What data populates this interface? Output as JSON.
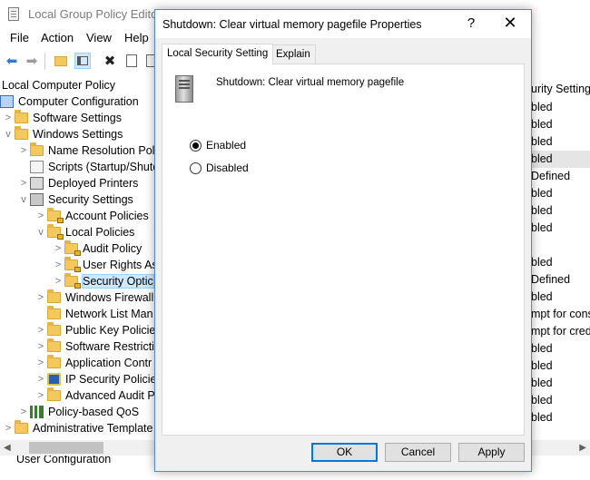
{
  "editor": {
    "title": "Local Group Policy Editor",
    "menu": [
      "File",
      "Action",
      "View",
      "Help"
    ],
    "toolbar_icons": [
      "back-arrow-icon",
      "forward-arrow-icon",
      "up-folder-icon",
      "show-hide-tree-icon",
      "delete-icon",
      "properties-icon",
      "export-list-icon"
    ],
    "tree": [
      {
        "label": "Local Computer Policy",
        "icon": "computer-icon"
      },
      {
        "label": "Computer Configuration",
        "icon": "computer-icon"
      },
      {
        "label": "Software Settings",
        "icon": "folder-icon"
      },
      {
        "label": "Windows Settings",
        "icon": "folder-icon"
      },
      {
        "label": "Name Resolution Pol",
        "icon": "folder-icon"
      },
      {
        "label": "Scripts (Startup/Shutd",
        "icon": "script-icon"
      },
      {
        "label": "Deployed Printers",
        "icon": "printer-icon"
      },
      {
        "label": "Security Settings",
        "icon": "security-settings-icon"
      },
      {
        "label": "Account Policies",
        "icon": "locked-folder-icon"
      },
      {
        "label": "Local Policies",
        "icon": "locked-folder-icon"
      },
      {
        "label": "Audit Policy",
        "icon": "locked-folder-icon"
      },
      {
        "label": "User Rights As",
        "icon": "locked-folder-icon"
      },
      {
        "label": "Security Optic",
        "icon": "locked-folder-icon"
      },
      {
        "label": "Windows Firewall",
        "icon": "folder-icon"
      },
      {
        "label": "Network List Man",
        "icon": "folder-icon"
      },
      {
        "label": "Public Key Policie",
        "icon": "folder-icon"
      },
      {
        "label": "Software Restricti",
        "icon": "folder-icon"
      },
      {
        "label": "Application Contr",
        "icon": "folder-icon"
      },
      {
        "label": "IP Security Policie",
        "icon": "ip-security-icon"
      },
      {
        "label": "Advanced Audit P",
        "icon": "folder-icon"
      },
      {
        "label": "Policy-based QoS",
        "icon": "qos-icon"
      },
      {
        "label": "Administrative Template",
        "icon": "folder-icon"
      }
    ],
    "list_header": "urity Setting",
    "list_values": [
      "bled",
      "bled",
      "bled",
      "bled",
      "Defined",
      "bled",
      "bled",
      "bled",
      "",
      "bled",
      "Defined",
      "bled",
      "mpt for cons",
      "mpt for cred",
      "bled",
      "bled",
      "bled",
      "bled",
      "bled"
    ],
    "bottom_partial": "User Configuration"
  },
  "dialog": {
    "title": "Shutdown: Clear virtual memory pagefile Properties",
    "help_glyph": "?",
    "close_glyph": "✕",
    "tabs": [
      "Local Security Setting",
      "Explain"
    ],
    "active_tab": 0,
    "policy_name": "Shutdown: Clear virtual memory pagefile",
    "options": [
      {
        "label": "Enabled",
        "checked": true
      },
      {
        "label": "Disabled",
        "checked": false
      }
    ],
    "buttons": {
      "ok": "OK",
      "cancel": "Cancel",
      "apply": "Apply"
    }
  },
  "colors": {
    "selection": "#cde8ff",
    "dialog_border": "#4f88d6",
    "default_button_border": "#0078d7"
  }
}
